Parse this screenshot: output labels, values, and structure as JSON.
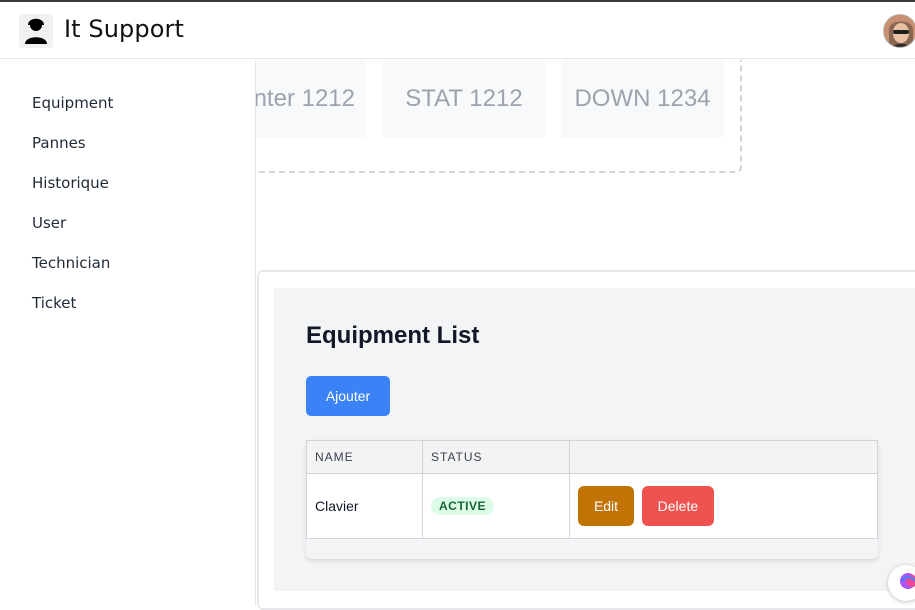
{
  "header": {
    "app_title": "It Support",
    "logo_icon": "support-agent-icon",
    "avatar_icon": "user-avatar"
  },
  "sidebar": {
    "items": [
      {
        "label": "Equipment"
      },
      {
        "label": "Pannes"
      },
      {
        "label": "Historique"
      },
      {
        "label": "User"
      },
      {
        "label": "Technician"
      },
      {
        "label": "Ticket"
      }
    ]
  },
  "stats": [
    {
      "label": "nter 1212"
    },
    {
      "label": "STAT 1212"
    },
    {
      "label": "DOWN 1234"
    }
  ],
  "equipment": {
    "title": "Equipment List",
    "add_label": "Ajouter",
    "columns": [
      "NAME",
      "STATUS",
      ""
    ],
    "rows": [
      {
        "name": "Clavier",
        "status": "ACTIVE",
        "edit_label": "Edit",
        "delete_label": "Delete"
      }
    ]
  },
  "colors": {
    "primary": "#3b82f6",
    "edit": "#c27306",
    "delete": "#ef5350",
    "active_badge_bg": "#dcfce7",
    "active_badge_text": "#166534"
  }
}
